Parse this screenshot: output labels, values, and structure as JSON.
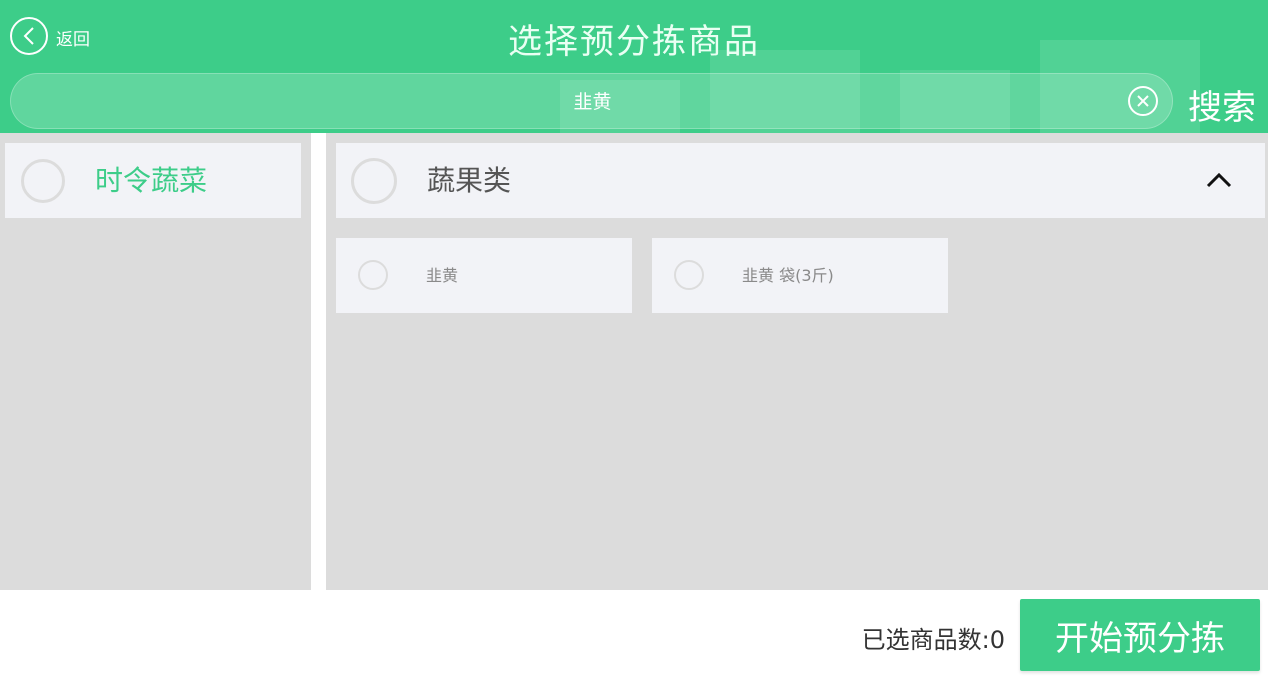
{
  "header": {
    "back_label": "返回",
    "title": "选择预分拣商品",
    "back_icon": "chevron-left-icon"
  },
  "search": {
    "value": "韭黄",
    "clear_icon": "close-circle-icon",
    "button_label": "搜索"
  },
  "categories": [
    {
      "label": "时令蔬菜",
      "selected": false
    }
  ],
  "group": {
    "label": "蔬果类",
    "expanded": true,
    "chevron_icon": "chevron-up-icon"
  },
  "products": [
    {
      "label": "韭黄",
      "selected": false
    },
    {
      "label": "韭黄 袋(3斤)",
      "selected": false
    }
  ],
  "footer": {
    "count_label": "已选商品数:0",
    "start_button": "开始预分拣"
  },
  "colors": {
    "accent": "#3dcd89",
    "panel_bg": "#dcdcdc",
    "item_bg": "#f2f3f7"
  }
}
